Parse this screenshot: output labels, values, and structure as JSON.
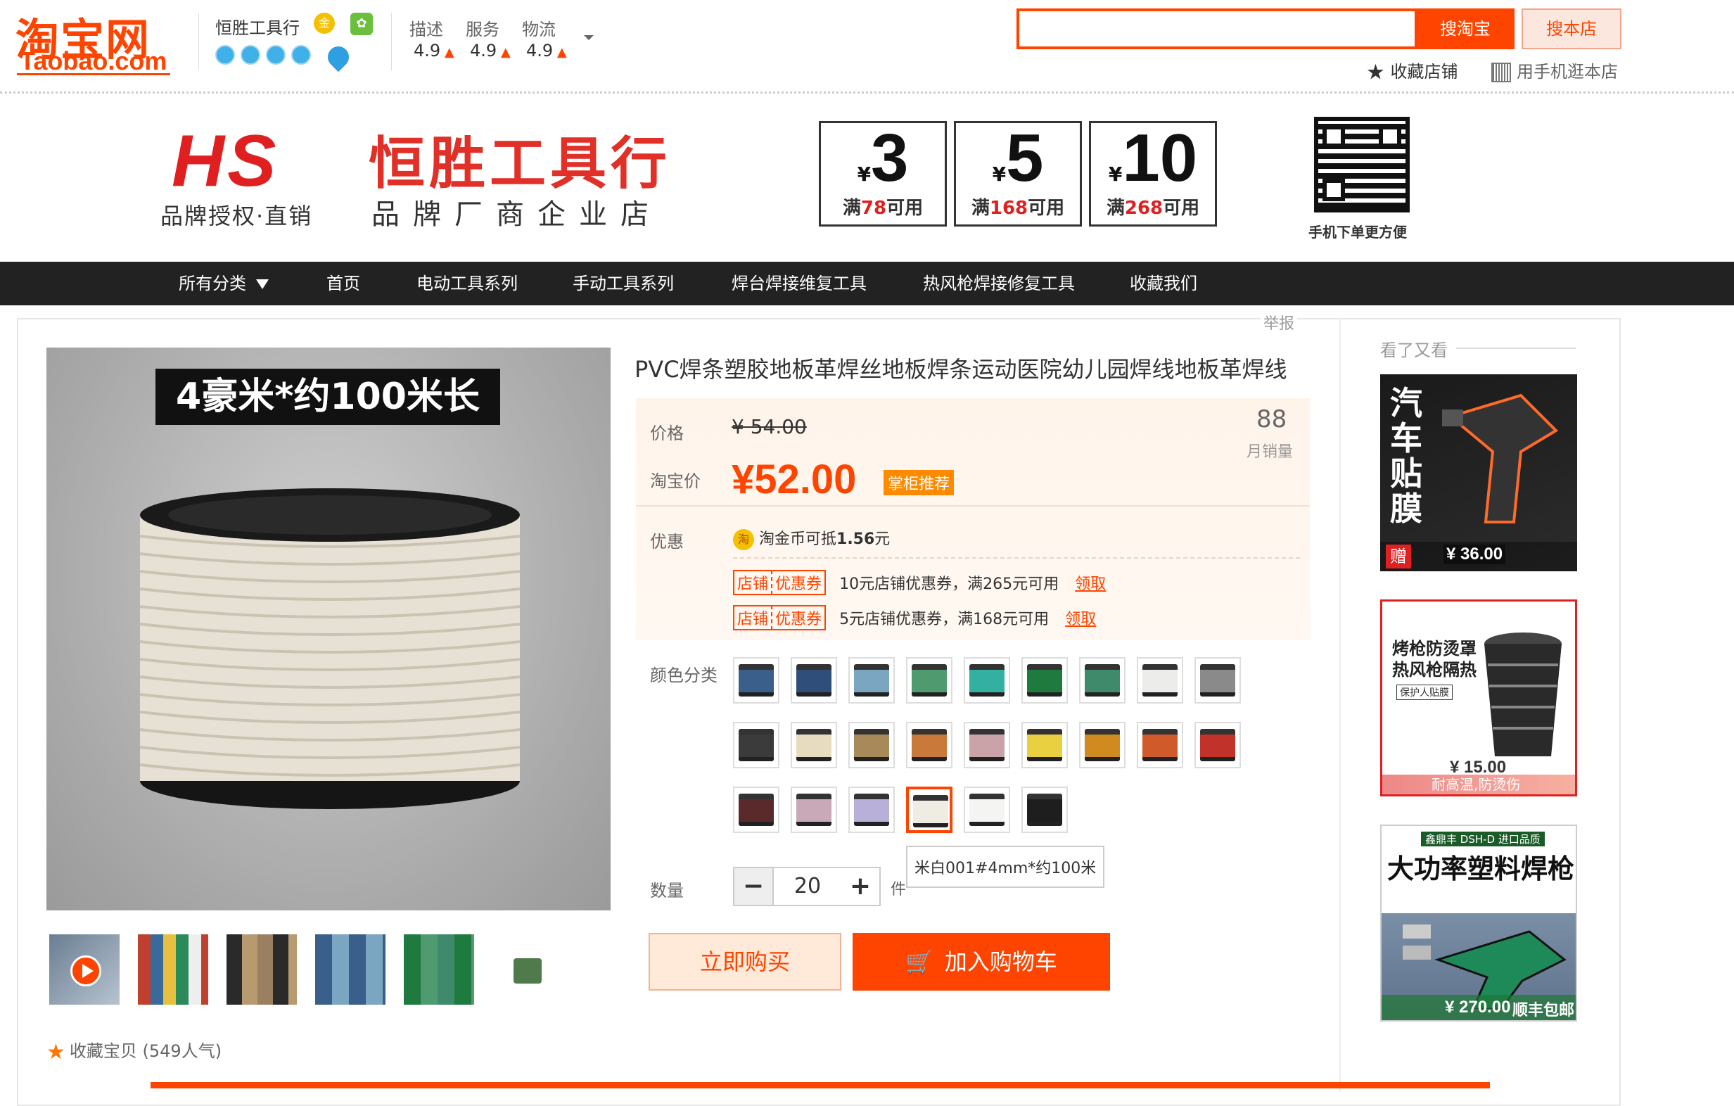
{
  "header": {
    "logo_cn": "淘宝网",
    "logo_en": "Taobao.com",
    "shop_name": "恒胜工具行",
    "ratings": [
      {
        "label": "描述",
        "value": "4.9"
      },
      {
        "label": "服务",
        "value": "4.9"
      },
      {
        "label": "物流",
        "value": "4.9"
      }
    ],
    "search": {
      "placeholder": "",
      "btn_taobao": "搜淘宝",
      "btn_shop": "搜本店"
    },
    "fav_shop": "收藏店铺",
    "phone_shop": "用手机逛本店"
  },
  "banner": {
    "logo": "HS",
    "logo_sub": "品牌授权·直销",
    "shop_big": "恒胜工具行",
    "shop_small": "品牌厂商企业店",
    "coupons": [
      {
        "yen": "¥",
        "amount": "3",
        "cond_pre": "满",
        "cond_num": "78",
        "cond_post": "可用"
      },
      {
        "yen": "¥",
        "amount": "5",
        "cond_pre": "满",
        "cond_num": "168",
        "cond_post": "可用"
      },
      {
        "yen": "¥",
        "amount": "10",
        "cond_pre": "满",
        "cond_num": "268",
        "cond_post": "可用"
      }
    ],
    "qr_caption": "手机下单更方便"
  },
  "nav": {
    "items": [
      "所有分类",
      "首页",
      "电动工具系列",
      "手动工具系列",
      "焊台焊接维复工具",
      "热风枪焊接修复工具",
      "收藏我们"
    ]
  },
  "product": {
    "report": "举报",
    "image_caption": "4豪米*约100米长",
    "title": "PVC焊条塑胶地板革焊丝地板焊条运动医院幼儿园焊线地板革焊线",
    "price_label": "价格",
    "old_price": "¥ 54.00",
    "tb_price_label": "淘宝价",
    "now_price": "¥52.00",
    "recommend_tag": "掌柜推荐",
    "sales_count": "88",
    "sales_label": "月销量",
    "promo_label": "优惠",
    "coin_icon_text": "淘",
    "coin_text_pre": "淘金币可抵",
    "coin_amount": "1.56",
    "coin_text_post": "元",
    "coupons": [
      {
        "tag_shop": "店铺",
        "tag_coupon": "优惠券",
        "text": "10元店铺优惠券，满265元可用",
        "link": "领取"
      },
      {
        "tag_shop": "店铺",
        "tag_coupon": "优惠券",
        "text": "5元店铺优惠券，满168元可用",
        "link": "领取"
      }
    ],
    "color_label": "颜色分类",
    "swatch_colors": [
      "#3a5f8a",
      "#2f4f7a",
      "#7aa6c2",
      "#4f9a6e",
      "#33b0a0",
      "#1e7a3e",
      "#3f8a6a",
      "#ececea",
      "#8a8a8a",
      "#3b3b3b",
      "#e8dcc0",
      "#a88a5a",
      "#c97a3a",
      "#c9a3a8",
      "#e8d040",
      "#d08a20",
      "#d05a2a",
      "#c0322a",
      "#5a2a2a",
      "#c9a8b8",
      "#b8b0d8",
      "#efece4",
      "#f4f4f2",
      "#1e1e1e"
    ],
    "selected_swatch": 21,
    "tooltip": "米白001#4mm*约100米",
    "qty_label": "数量",
    "qty_value": "20",
    "qty_unit": "件",
    "btn_buy": "立即购买",
    "btn_cart": "加入购物车",
    "fav_item": "收藏宝贝 (549人气)"
  },
  "sidebar": {
    "title": "看了又看",
    "items": [
      {
        "price": "¥ 36.00",
        "headline": "汽车贴膜",
        "tag": "赠"
      },
      {
        "price": "¥ 15.00",
        "headline": "烤枪防烫罩\n热风枪隔热",
        "tag": "保护人贴膜",
        "footer": "耐高温,防烫伤"
      },
      {
        "price": "¥ 270.00",
        "headline": "大功率塑料焊枪",
        "brand": "鑫鼎丰 DSH-D 进口品质",
        "footer": "顺丰包邮"
      }
    ]
  },
  "colors": {
    "accent": "#ff4400",
    "nav_bg": "#222222",
    "price_bg": "#fff4ea"
  }
}
